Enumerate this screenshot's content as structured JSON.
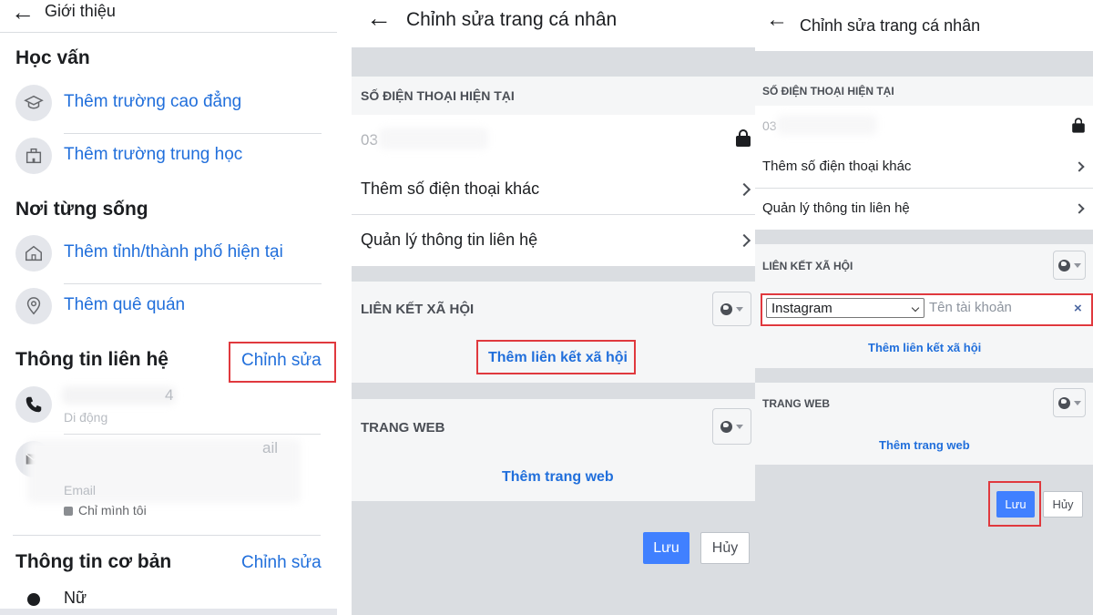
{
  "panel1": {
    "title": "Giới thiệu",
    "education": {
      "heading": "Học vấn",
      "items": [
        "Thêm trường cao đẳng",
        "Thêm trường trung học"
      ]
    },
    "places": {
      "heading": "Nơi từng sống",
      "items": [
        "Thêm tỉnh/thành phố hiện tại",
        "Thêm quê quán"
      ]
    },
    "contact": {
      "heading": "Thông tin liên hệ",
      "edit_label": "Chỉnh sửa",
      "phone_fragment": "4",
      "phone_type": "Di động",
      "email_fragment": "ail",
      "email_type": "Email",
      "privacy": "Chỉ mình tôi"
    },
    "basic": {
      "heading": "Thông tin cơ bản",
      "edit_label": "Chỉnh sửa",
      "gender": "Nữ"
    }
  },
  "panel2": {
    "title": "Chỉnh sửa trang cá nhân",
    "phone_section": "SỐ ĐIỆN THOẠI HIỆN TẠI",
    "phone_prefix": "03",
    "add_phone": "Thêm số điện thoại khác",
    "manage_contact": "Quản lý thông tin liên hệ",
    "social_section": "LIÊN KẾT XÃ HỘI",
    "add_social": "Thêm liên kết xã hội",
    "web_section": "TRANG WEB",
    "add_web": "Thêm trang web",
    "save": "Lưu",
    "cancel": "Hủy"
  },
  "panel3": {
    "title": "Chỉnh sửa trang cá nhân",
    "phone_section": "SỐ ĐIỆN THOẠI HIỆN TẠI",
    "phone_prefix": "03",
    "add_phone": "Thêm số điện thoại khác",
    "manage_contact": "Quản lý thông tin liên hệ",
    "social_section": "LIÊN KẾT XÃ HỘI",
    "social_select": "Instagram",
    "account_placeholder": "Tên tài khoản",
    "remove": "×",
    "add_social": "Thêm liên kết xã hội",
    "web_section": "TRANG WEB",
    "add_web": "Thêm trang web",
    "save": "Lưu",
    "cancel": "Hủy"
  },
  "colors": {
    "link_blue": "#216fdb",
    "primary_button": "#4080ff",
    "highlight_red": "#e0393e",
    "page_grey": "#dadde1"
  },
  "icons": [
    "back-arrow-icon",
    "graduation-cap-icon",
    "school-building-icon",
    "home-icon",
    "location-pin-icon",
    "phone-icon",
    "envelope-icon",
    "lock-icon",
    "person-icon",
    "chevron-right-icon",
    "globe-icon",
    "dropdown-caret-icon",
    "close-icon"
  ]
}
